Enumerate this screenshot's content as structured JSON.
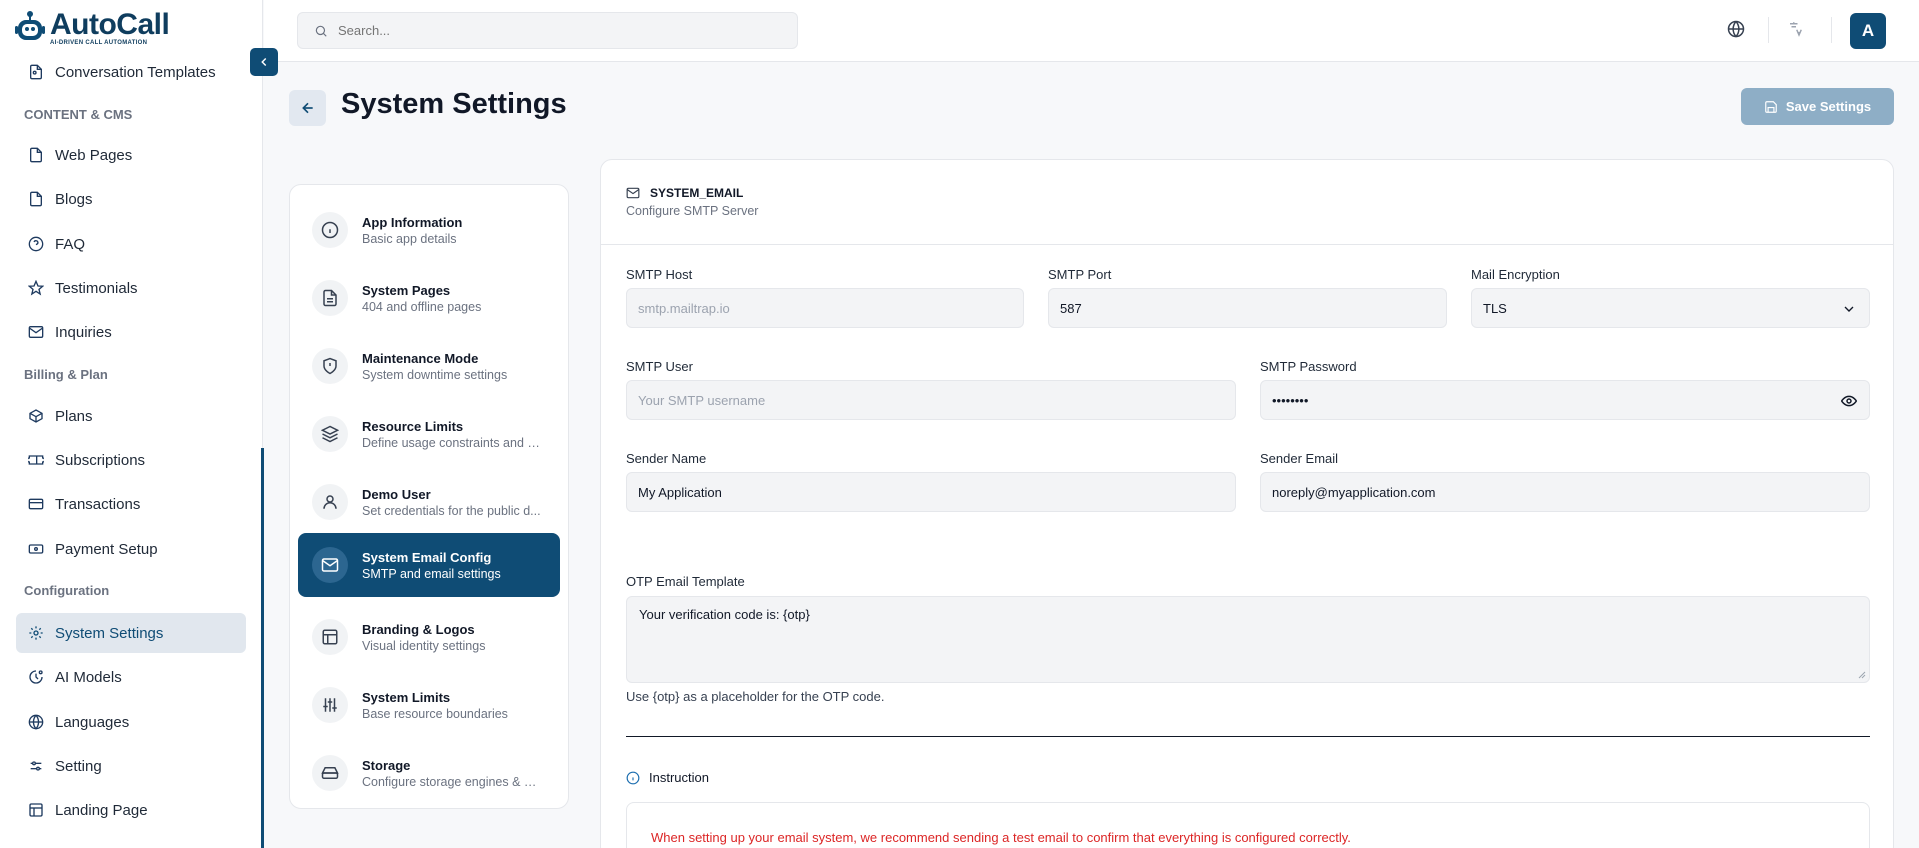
{
  "app": {
    "logo_title": "AutoCall",
    "logo_subtitle": "AI-DRIVEN CALL AUTOMATION",
    "brand_color": "#0f4c75"
  },
  "sidebar": {
    "items_top": [
      {
        "label": "Conversation Templates",
        "icon": "template-icon"
      }
    ],
    "sections": [
      {
        "title": "CONTENT & CMS",
        "items": [
          {
            "label": "Web Pages",
            "icon": "file-icon"
          },
          {
            "label": "Blogs",
            "icon": "file-icon"
          },
          {
            "label": "FAQ",
            "icon": "help-circle-icon"
          },
          {
            "label": "Testimonials",
            "icon": "star-icon"
          },
          {
            "label": "Inquiries",
            "icon": "mail-icon"
          }
        ]
      },
      {
        "title": "Billing & Plan",
        "items": [
          {
            "label": "Plans",
            "icon": "package-icon"
          },
          {
            "label": "Subscriptions",
            "icon": "ticket-icon"
          },
          {
            "label": "Transactions",
            "icon": "wallet-icon"
          },
          {
            "label": "Payment Setup",
            "icon": "banknote-icon"
          }
        ]
      },
      {
        "title": "Configuration",
        "items": [
          {
            "label": "System Settings",
            "icon": "gear-icon",
            "active": true
          },
          {
            "label": "AI Models",
            "icon": "ai-icon"
          },
          {
            "label": "Languages",
            "icon": "globe-icon"
          },
          {
            "label": "Setting",
            "icon": "sliders-icon"
          },
          {
            "label": "Landing Page",
            "icon": "layout-icon"
          }
        ]
      }
    ]
  },
  "header": {
    "search_placeholder": "Search...",
    "avatar_initial": "A"
  },
  "page": {
    "title": "System Settings",
    "save_label": "Save Settings"
  },
  "settings_menu": [
    {
      "title": "App Information",
      "desc": "Basic app details",
      "icon": "info-icon"
    },
    {
      "title": "System Pages",
      "desc": "404 and offline pages",
      "icon": "document-icon"
    },
    {
      "title": "Maintenance Mode",
      "desc": "System downtime settings",
      "icon": "shield-alert-icon"
    },
    {
      "title": "Resource Limits",
      "desc": "Define usage constraints and s...",
      "icon": "layers-icon"
    },
    {
      "title": "Demo User",
      "desc": "Set credentials for the public d...",
      "icon": "user-icon"
    },
    {
      "title": "System Email Config",
      "desc": "SMTP and email settings",
      "icon": "mail-icon",
      "active": true
    },
    {
      "title": "Branding & Logos",
      "desc": "Visual identity settings",
      "icon": "layout-icon"
    },
    {
      "title": "System Limits",
      "desc": "Base resource boundaries",
      "icon": "sliders-icon"
    },
    {
      "title": "Storage",
      "desc": "Configure storage engines & S...",
      "icon": "hard-drive-icon"
    }
  ],
  "panel": {
    "title": "SYSTEM_EMAIL",
    "subtitle": "Configure SMTP Server",
    "smtp_host_label": "SMTP Host",
    "smtp_host_placeholder": "smtp.mailtrap.io",
    "smtp_port_label": "SMTP Port",
    "smtp_port_value": "587",
    "encryption_label": "Mail Encryption",
    "encryption_value": "TLS",
    "smtp_user_label": "SMTP User",
    "smtp_user_placeholder": "Your SMTP username",
    "smtp_password_label": "SMTP Password",
    "smtp_password_value": "••••••••",
    "sender_name_label": "Sender Name",
    "sender_name_value": "My Application",
    "sender_email_label": "Sender Email",
    "sender_email_value": "noreply@myapplication.com",
    "otp_label": "OTP Email Template",
    "otp_value": "Your verification code is: {otp}",
    "otp_hint": "Use {otp} as a placeholder for the OTP code.",
    "instruction_title": "Instruction",
    "instruction_text": "When setting up your email system, we recommend sending a test email to confirm that everything is configured correctly."
  }
}
